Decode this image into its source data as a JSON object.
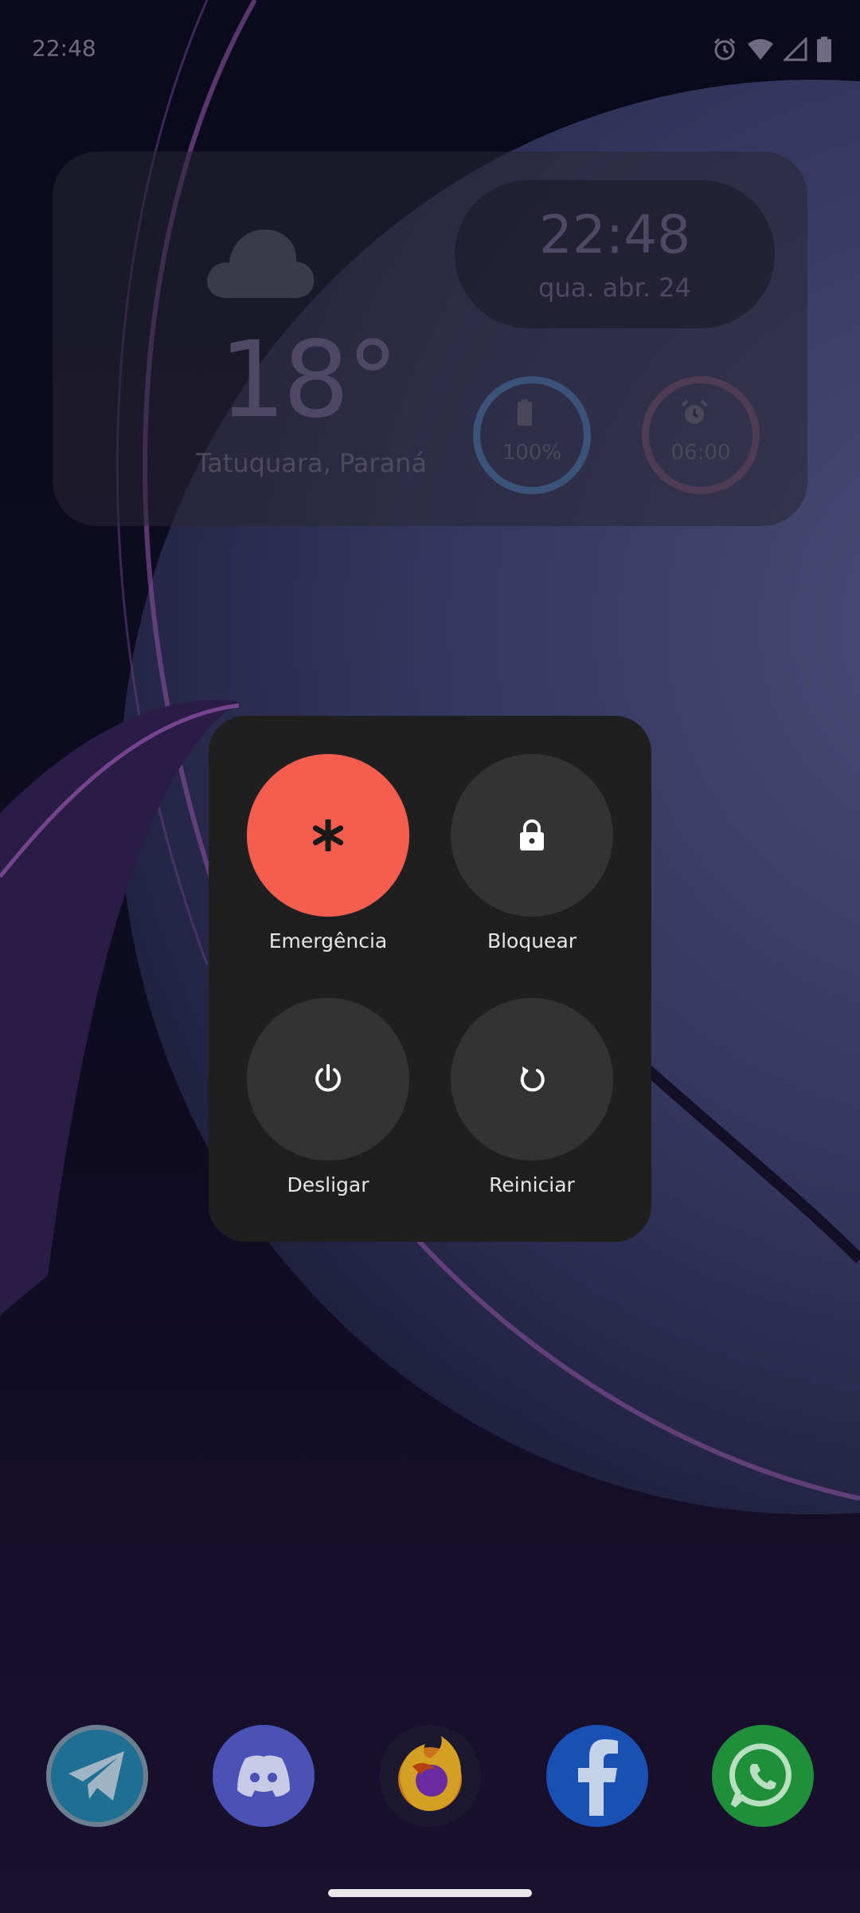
{
  "status_bar": {
    "time": "22:48",
    "icons": [
      "alarm-icon",
      "wifi-icon",
      "signal-icon",
      "battery-icon"
    ]
  },
  "widget": {
    "weather_icon": "cloud-icon",
    "temperature": "18°",
    "location": "Tatuquara, Paraná",
    "clock_time": "22:48",
    "clock_date": "qua. abr. 24",
    "battery_label": "100%",
    "battery_level": 1.0,
    "alarm_label": "06:00"
  },
  "power_menu": {
    "emergency_label": "Emergência",
    "lock_label": "Bloquear",
    "power_off_label": "Desligar",
    "restart_label": "Reiniciar",
    "emergency_color": "#f45e4f",
    "button_color": "#333333"
  },
  "dock": {
    "apps": [
      "telegram-icon",
      "discord-icon",
      "firefox-icon",
      "facebook-icon",
      "whatsapp-icon"
    ]
  }
}
